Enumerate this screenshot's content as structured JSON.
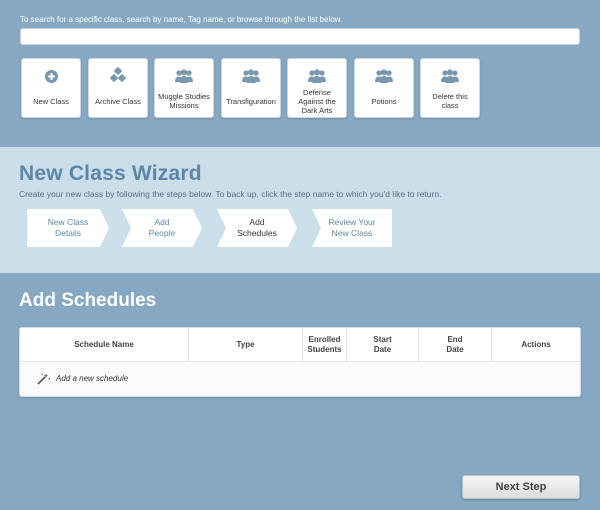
{
  "search": {
    "help_text": "To search for a specific class, search by name, Tag name, or browse through the list below.",
    "value": "",
    "placeholder": ""
  },
  "tiles": [
    {
      "label": "New Class",
      "icon": "plus-circle-icon"
    },
    {
      "label": "Archive Class",
      "icon": "cubes-icon"
    },
    {
      "label": "Muggle Studies Missions",
      "icon": "group-icon"
    },
    {
      "label": "Transfiguration",
      "icon": "group-icon"
    },
    {
      "label": "Defense Against the Dark Arts",
      "icon": "group-icon"
    },
    {
      "label": "Potions",
      "icon": "group-icon"
    },
    {
      "label": "Delete this class",
      "icon": "group-icon"
    }
  ],
  "wizard": {
    "title": "New Class Wizard",
    "subtitle": "Create your new class by following the steps below. To back up, click the step name to which you'd like to return.",
    "steps": [
      {
        "line1": "New Class",
        "line2": "Details"
      },
      {
        "line1": "Add",
        "line2": "People"
      },
      {
        "line1": "Add",
        "line2": "Schedules",
        "active": true
      },
      {
        "line1": "Review Your",
        "line2": "New Class"
      }
    ]
  },
  "schedules": {
    "title": "Add Schedules",
    "columns": [
      {
        "l1": "Schedule Name",
        "l2": ""
      },
      {
        "l1": "Type",
        "l2": ""
      },
      {
        "l1": "Enrolled",
        "l2": "Students"
      },
      {
        "l1": "Start",
        "l2": "Date"
      },
      {
        "l1": "End",
        "l2": "Date"
      },
      {
        "l1": "Actions",
        "l2": ""
      }
    ],
    "add_label": "Add a new schedule"
  },
  "footer": {
    "next_label": "Next Step"
  },
  "colors": {
    "page_bg": "#86a8c2",
    "wizard_bg": "#cbdfeb",
    "wizard_title": "#5d86a6",
    "icon": "#7a98ad"
  }
}
